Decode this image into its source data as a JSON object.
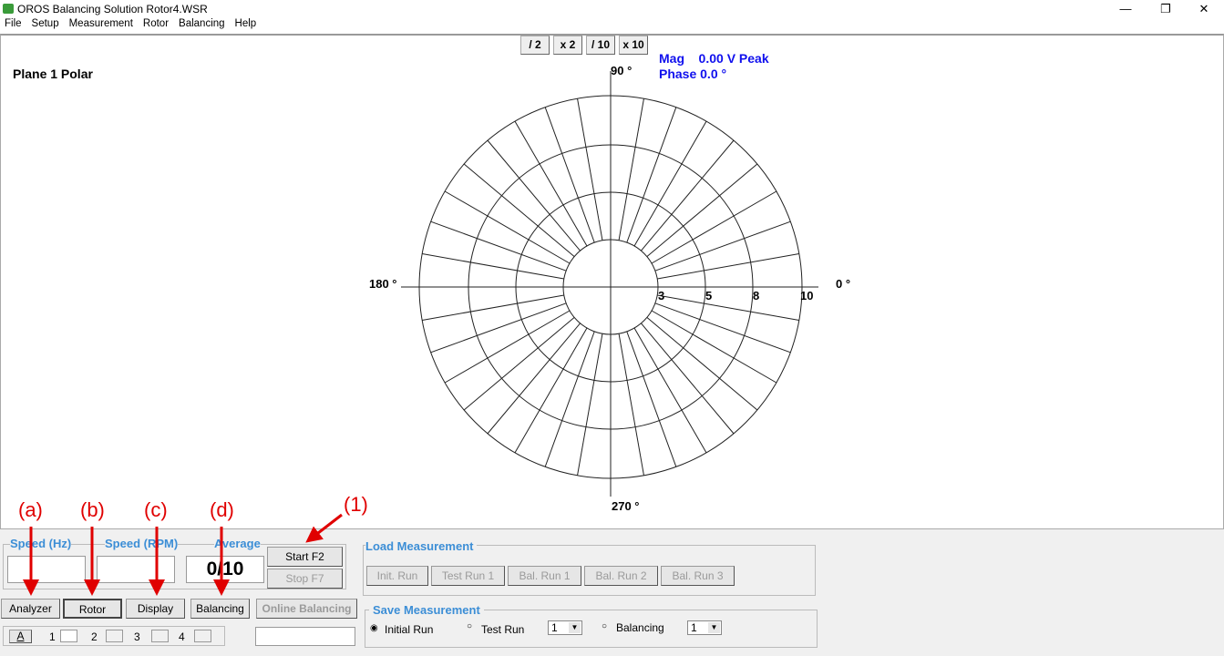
{
  "window": {
    "title": "OROS Balancing Solution Rotor4.WSR",
    "minimize": "—",
    "restore": "❐",
    "close": "✕"
  },
  "menu": [
    "File",
    "Setup",
    "Measurement",
    "Rotor",
    "Balancing",
    "Help"
  ],
  "plot": {
    "title": "Plane 1  Polar",
    "scale_buttons": [
      "/ 2",
      "x 2",
      "/ 10",
      "x 10"
    ],
    "mag": "Mag    0.00 V Peak",
    "phase": "Phase 0.0 °",
    "angle_labels": {
      "a90": "90 °",
      "a180": "180 °",
      "a0": "0 °",
      "a270": "270 °"
    },
    "ring_labels": [
      "3",
      "5",
      "8",
      "10"
    ]
  },
  "panel": {
    "speed_hz": "Speed (Hz)",
    "speed_rpm": "Speed (RPM)",
    "average": "Average",
    "average_value": "0/10",
    "start": "Start F2",
    "stop": "Stop F7",
    "nav": [
      "Analyzer",
      "Rotor",
      "Display",
      "Balancing",
      "Online Balancing"
    ],
    "channel_btn": "A",
    "channels": [
      "1",
      "2",
      "3",
      "4"
    ],
    "load": {
      "title": "Load Measurement",
      "buttons": [
        "Init. Run",
        "Test Run 1",
        "Bal. Run 1",
        "Bal. Run 2",
        "Bal. Run 3"
      ]
    },
    "save": {
      "title": "Save Measurement",
      "initial": "Initial Run",
      "test": "Test Run",
      "test_sel": "1",
      "balancing": "Balancing",
      "bal_sel": "1"
    }
  },
  "annotations": [
    "(a)",
    "(b)",
    "(c)",
    "(d)",
    "(1)"
  ],
  "colors": {
    "accent": "#3c8ed6",
    "readout": "#1010ee",
    "annotation": "#e00000"
  }
}
